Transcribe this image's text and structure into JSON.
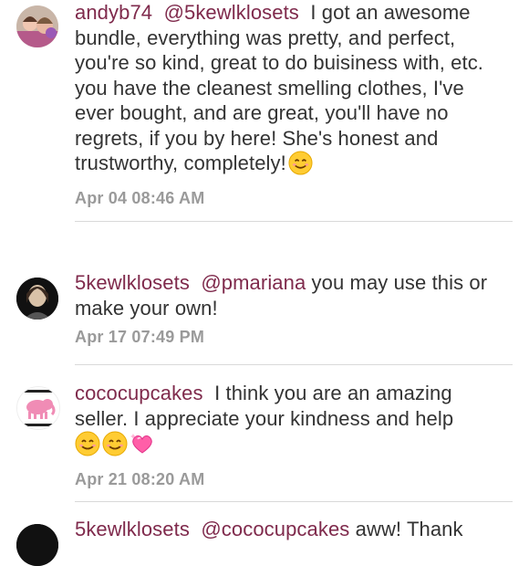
{
  "comments": [
    {
      "username": "andyb74",
      "mention": "@5kewlklosets",
      "text": "I got an awesome bundle, everything was pretty, and perfect, you're so kind, great to do buisiness with, etc. you have the cleanest smelling clothes, I've ever bought, and are great, you'll have no regrets, if you by here! She's honest and trustworthy, completely!",
      "emojis": [
        "smiling-face-emoji"
      ],
      "timestamp": "Apr 04 08:46 AM"
    },
    {
      "username": "5kewlklosets",
      "mention": "@pmariana",
      "text": "you may use this or make your own!",
      "emojis": [],
      "timestamp": "Apr 17 07:49 PM"
    },
    {
      "username": "cococupcakes",
      "mention": "",
      "text": "I think you are an amazing seller. I appreciate your kindness and help",
      "emojis": [
        "smiling-face-emoji",
        "smiling-face-emoji",
        "sparkling-heart-emoji"
      ],
      "timestamp": "Apr 21 08:20 AM"
    },
    {
      "username": "5kewlklosets",
      "mention": "@cococupcakes",
      "text": "aww! Thank",
      "emojis": [],
      "timestamp": ""
    }
  ],
  "colors": {
    "username": "#7f2a4c",
    "text": "#333333",
    "timestamp": "#9a9a9a",
    "divider": "#d9d9d9"
  }
}
